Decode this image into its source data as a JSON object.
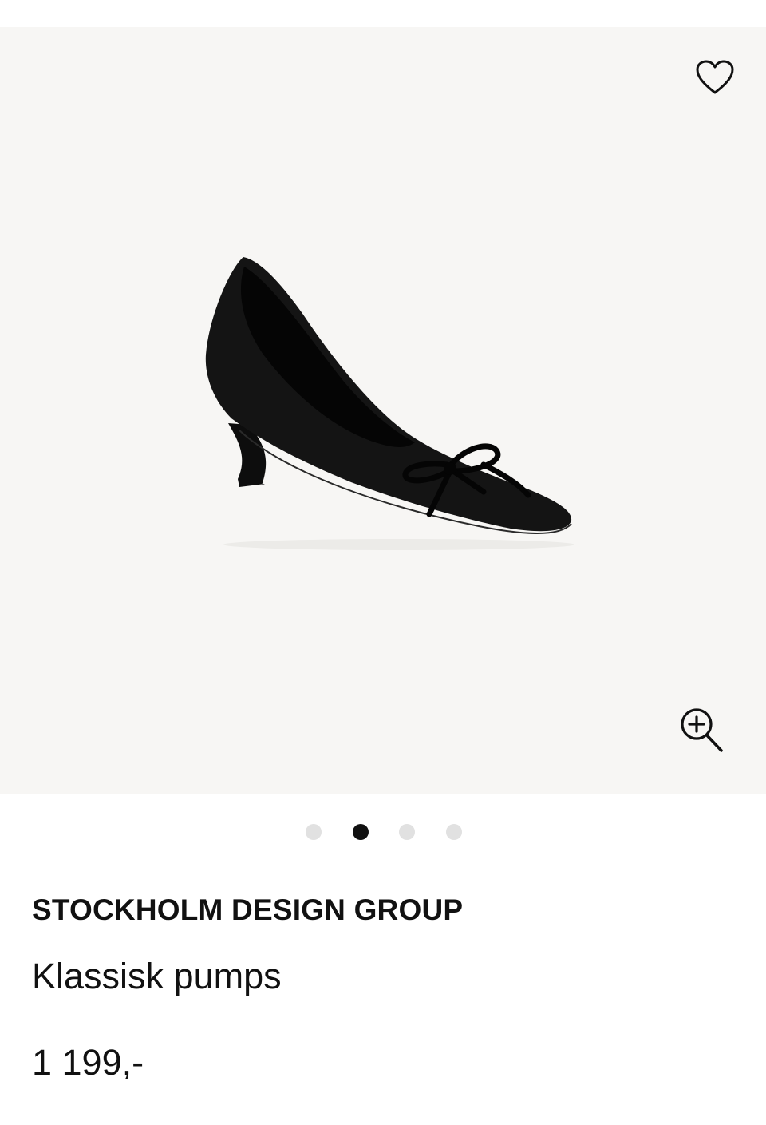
{
  "gallery": {
    "image_alt": "Klassisk pumps",
    "favorite_icon": "heart-icon",
    "zoom_icon": "zoom-in-icon",
    "slide_count": 4,
    "active_slide": 2,
    "background_color": "#f7f6f4"
  },
  "product": {
    "brand": "STOCKHOLM DESIGN GROUP",
    "name": "Klassisk pumps",
    "price": "1 199,-"
  },
  "colors": {
    "text": "#111111",
    "dot_inactive": "#e1e1e1",
    "dot_active": "#111111"
  }
}
